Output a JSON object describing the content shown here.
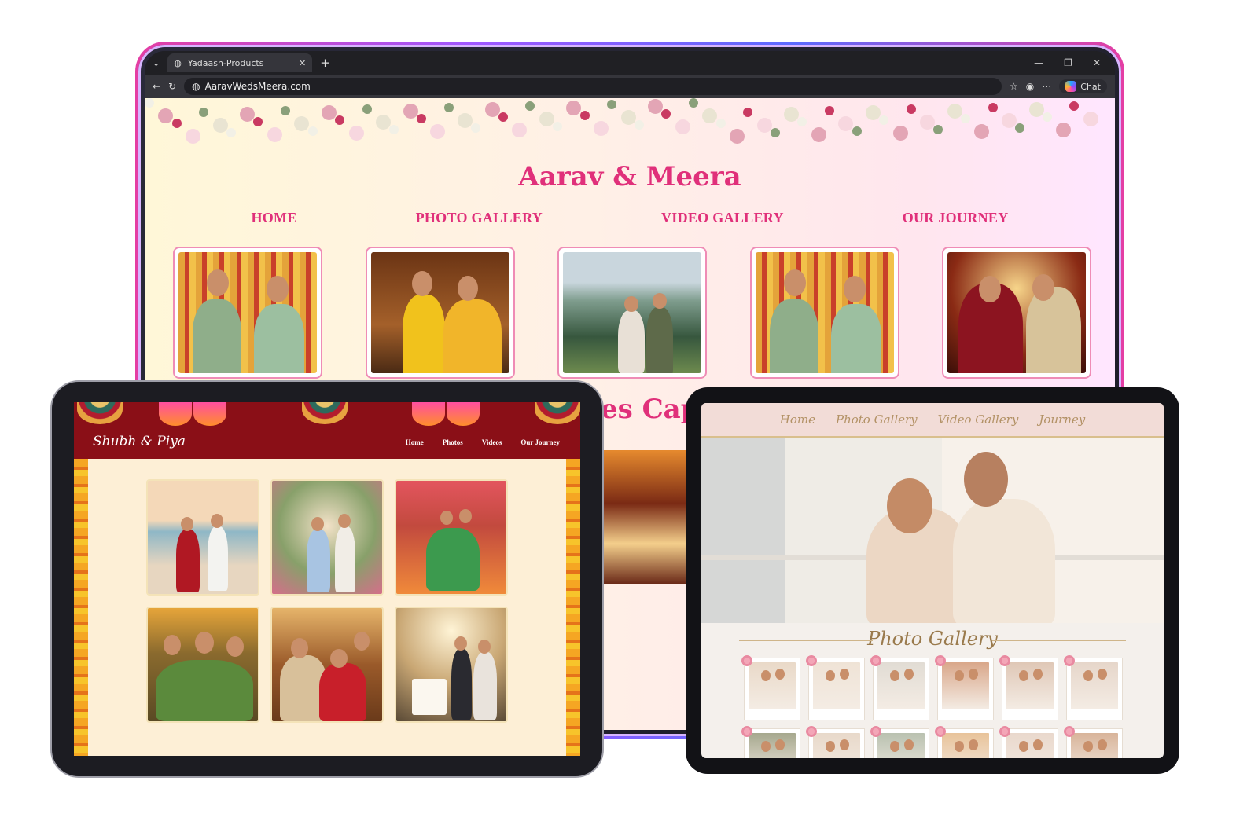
{
  "browser": {
    "tab_title": "Yadaash-Products",
    "url": "AaravWedsMeera.com",
    "chat_label": "Chat"
  },
  "site1": {
    "title": "Aarav & Meera",
    "nav": [
      "HOME",
      "PHOTO GALLERY",
      "VIDEO GALLERY",
      "OUR JOURNEY"
    ],
    "section_partial": "es Capt"
  },
  "site2": {
    "brand": "Shubh & Piya",
    "nav": [
      "Home",
      "Photos",
      "Videos",
      "Our Journey"
    ]
  },
  "site3": {
    "nav": [
      "Home",
      "Photo Gallery",
      "Video Gallery",
      "Journey"
    ],
    "gallery_title": "Photo Gallery"
  },
  "icons": [
    "globe-icon",
    "back-icon",
    "refresh-icon",
    "star-icon",
    "profile-icon",
    "more-icon",
    "copilot-icon"
  ],
  "colors": {
    "site1_accent": "#e0307a",
    "site2_header": "#8a0f17",
    "site3_gold": "#b39266"
  }
}
